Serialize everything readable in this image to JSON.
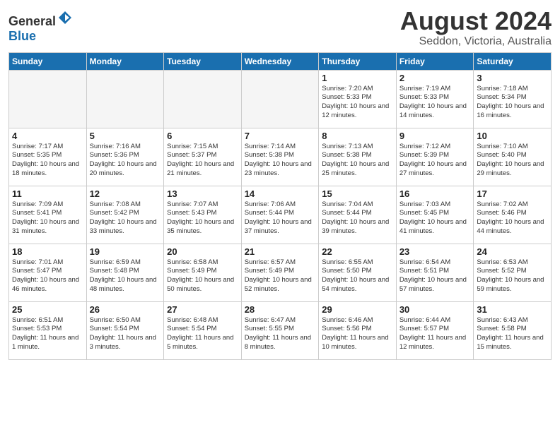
{
  "header": {
    "logo_general": "General",
    "logo_blue": "Blue",
    "month_year": "August 2024",
    "location": "Seddon, Victoria, Australia"
  },
  "days_of_week": [
    "Sunday",
    "Monday",
    "Tuesday",
    "Wednesday",
    "Thursday",
    "Friday",
    "Saturday"
  ],
  "weeks": [
    [
      {
        "day": "",
        "empty": true
      },
      {
        "day": "",
        "empty": true
      },
      {
        "day": "",
        "empty": true
      },
      {
        "day": "",
        "empty": true
      },
      {
        "day": "1",
        "sunrise": "7:20 AM",
        "sunset": "5:33 PM",
        "daylight": "10 hours and 12 minutes."
      },
      {
        "day": "2",
        "sunrise": "7:19 AM",
        "sunset": "5:33 PM",
        "daylight": "10 hours and 14 minutes."
      },
      {
        "day": "3",
        "sunrise": "7:18 AM",
        "sunset": "5:34 PM",
        "daylight": "10 hours and 16 minutes."
      }
    ],
    [
      {
        "day": "4",
        "sunrise": "7:17 AM",
        "sunset": "5:35 PM",
        "daylight": "10 hours and 18 minutes."
      },
      {
        "day": "5",
        "sunrise": "7:16 AM",
        "sunset": "5:36 PM",
        "daylight": "10 hours and 20 minutes."
      },
      {
        "day": "6",
        "sunrise": "7:15 AM",
        "sunset": "5:37 PM",
        "daylight": "10 hours and 21 minutes."
      },
      {
        "day": "7",
        "sunrise": "7:14 AM",
        "sunset": "5:38 PM",
        "daylight": "10 hours and 23 minutes."
      },
      {
        "day": "8",
        "sunrise": "7:13 AM",
        "sunset": "5:38 PM",
        "daylight": "10 hours and 25 minutes."
      },
      {
        "day": "9",
        "sunrise": "7:12 AM",
        "sunset": "5:39 PM",
        "daylight": "10 hours and 27 minutes."
      },
      {
        "day": "10",
        "sunrise": "7:10 AM",
        "sunset": "5:40 PM",
        "daylight": "10 hours and 29 minutes."
      }
    ],
    [
      {
        "day": "11",
        "sunrise": "7:09 AM",
        "sunset": "5:41 PM",
        "daylight": "10 hours and 31 minutes."
      },
      {
        "day": "12",
        "sunrise": "7:08 AM",
        "sunset": "5:42 PM",
        "daylight": "10 hours and 33 minutes."
      },
      {
        "day": "13",
        "sunrise": "7:07 AM",
        "sunset": "5:43 PM",
        "daylight": "10 hours and 35 minutes."
      },
      {
        "day": "14",
        "sunrise": "7:06 AM",
        "sunset": "5:44 PM",
        "daylight": "10 hours and 37 minutes."
      },
      {
        "day": "15",
        "sunrise": "7:04 AM",
        "sunset": "5:44 PM",
        "daylight": "10 hours and 39 minutes."
      },
      {
        "day": "16",
        "sunrise": "7:03 AM",
        "sunset": "5:45 PM",
        "daylight": "10 hours and 41 minutes."
      },
      {
        "day": "17",
        "sunrise": "7:02 AM",
        "sunset": "5:46 PM",
        "daylight": "10 hours and 44 minutes."
      }
    ],
    [
      {
        "day": "18",
        "sunrise": "7:01 AM",
        "sunset": "5:47 PM",
        "daylight": "10 hours and 46 minutes."
      },
      {
        "day": "19",
        "sunrise": "6:59 AM",
        "sunset": "5:48 PM",
        "daylight": "10 hours and 48 minutes."
      },
      {
        "day": "20",
        "sunrise": "6:58 AM",
        "sunset": "5:49 PM",
        "daylight": "10 hours and 50 minutes."
      },
      {
        "day": "21",
        "sunrise": "6:57 AM",
        "sunset": "5:49 PM",
        "daylight": "10 hours and 52 minutes."
      },
      {
        "day": "22",
        "sunrise": "6:55 AM",
        "sunset": "5:50 PM",
        "daylight": "10 hours and 54 minutes."
      },
      {
        "day": "23",
        "sunrise": "6:54 AM",
        "sunset": "5:51 PM",
        "daylight": "10 hours and 57 minutes."
      },
      {
        "day": "24",
        "sunrise": "6:53 AM",
        "sunset": "5:52 PM",
        "daylight": "10 hours and 59 minutes."
      }
    ],
    [
      {
        "day": "25",
        "sunrise": "6:51 AM",
        "sunset": "5:53 PM",
        "daylight": "11 hours and 1 minute."
      },
      {
        "day": "26",
        "sunrise": "6:50 AM",
        "sunset": "5:54 PM",
        "daylight": "11 hours and 3 minutes."
      },
      {
        "day": "27",
        "sunrise": "6:48 AM",
        "sunset": "5:54 PM",
        "daylight": "11 hours and 5 minutes."
      },
      {
        "day": "28",
        "sunrise": "6:47 AM",
        "sunset": "5:55 PM",
        "daylight": "11 hours and 8 minutes."
      },
      {
        "day": "29",
        "sunrise": "6:46 AM",
        "sunset": "5:56 PM",
        "daylight": "11 hours and 10 minutes."
      },
      {
        "day": "30",
        "sunrise": "6:44 AM",
        "sunset": "5:57 PM",
        "daylight": "11 hours and 12 minutes."
      },
      {
        "day": "31",
        "sunrise": "6:43 AM",
        "sunset": "5:58 PM",
        "daylight": "11 hours and 15 minutes."
      }
    ]
  ]
}
